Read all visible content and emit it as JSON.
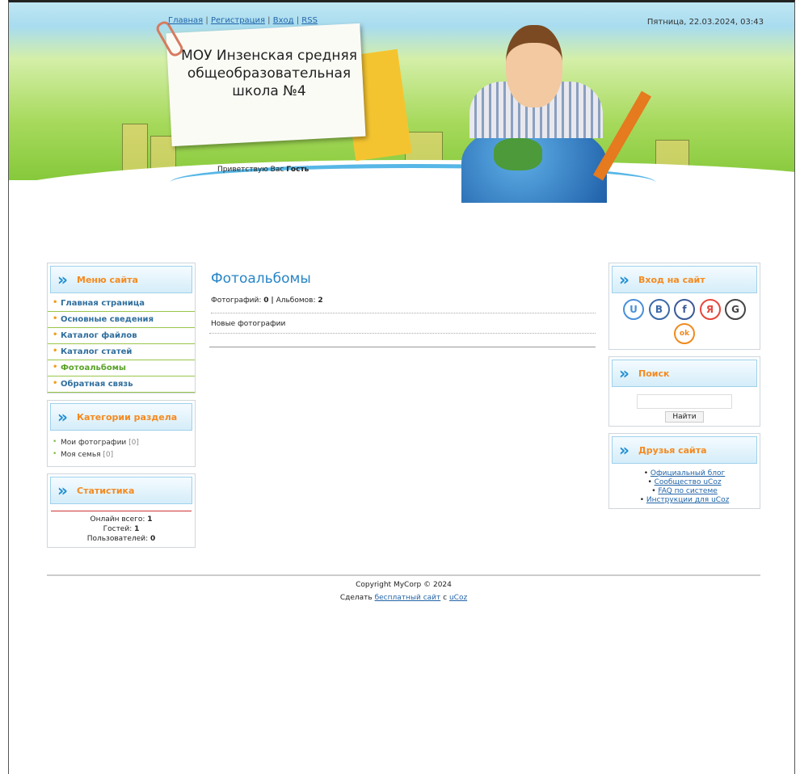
{
  "header": {
    "nav": [
      "Главная",
      "Регистрация",
      "Вход",
      "RSS"
    ],
    "datetime": "Пятница, 22.03.2024, 03:43",
    "site_title": "МОУ Инзенская средняя общеобразовательная школа №4",
    "greeting_prefix": "Приветствую Вас",
    "greeting_user": "Гость"
  },
  "menu": {
    "title": "Меню сайта",
    "items": [
      "Главная страница",
      "Основные сведения",
      "Каталог файлов",
      "Каталог статей",
      "Фотоальбомы",
      "Обратная связь"
    ]
  },
  "categories": {
    "title": "Категории раздела",
    "items": [
      {
        "label": "Мои фотографии",
        "count": "[0]"
      },
      {
        "label": "Моя семья",
        "count": "[0]"
      }
    ]
  },
  "stats": {
    "title": "Статистика",
    "online_label": "Онлайн всего:",
    "online_value": "1",
    "guests_label": "Гостей:",
    "guests_value": "1",
    "users_label": "Пользователей:",
    "users_value": "0"
  },
  "main": {
    "title": "Фотоальбомы",
    "photos_label": "Фотографий:",
    "photos_value": "0",
    "separator": "|",
    "albums_label": "Альбомов:",
    "albums_value": "2",
    "new_photos": "Новые фотографии"
  },
  "login": {
    "title": "Вход на сайт",
    "icons": [
      {
        "name": "ucoz-icon",
        "glyph": "U",
        "color": "#4a90d9"
      },
      {
        "name": "vk-icon",
        "glyph": "B",
        "color": "#3b6aa8"
      },
      {
        "name": "facebook-icon",
        "glyph": "f",
        "color": "#3b5998"
      },
      {
        "name": "yandex-icon",
        "glyph": "Я",
        "color": "#e5483d"
      },
      {
        "name": "google-icon",
        "glyph": "G",
        "color": "#444444"
      },
      {
        "name": "odnoklassniki-icon",
        "glyph": "ok",
        "color": "#f08a1e"
      }
    ]
  },
  "search": {
    "title": "Поиск",
    "button": "Найти"
  },
  "friends": {
    "title": "Друзья сайта",
    "links": [
      "Официальный блог",
      "Сообщество uCoz",
      "FAQ по системе",
      "Инструкции для uCoz"
    ]
  },
  "footer": {
    "copyright": "Copyright MyCorp © 2024",
    "make_prefix": "Сделать",
    "free_site": "бесплатный сайт",
    "with": "с",
    "ucoz": "uCoz"
  }
}
